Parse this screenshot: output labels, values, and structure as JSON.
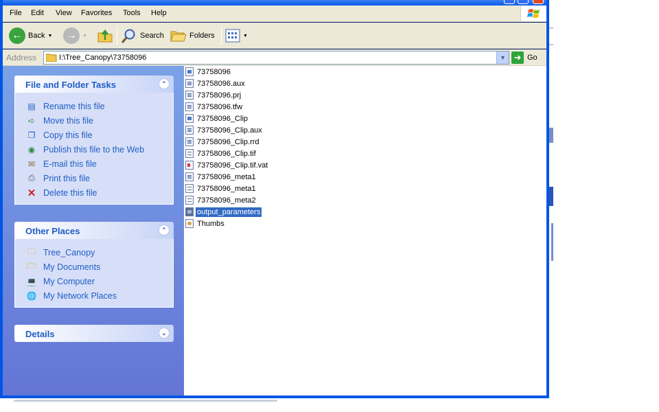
{
  "menu": {
    "items": [
      "File",
      "Edit",
      "View",
      "Favorites",
      "Tools",
      "Help"
    ]
  },
  "toolbar": {
    "back_label": "Back",
    "search_label": "Search",
    "folders_label": "Folders"
  },
  "address": {
    "label": "Address",
    "value": "I:\\Tree_Canopy\\73758096",
    "go_label": "Go"
  },
  "file_tasks": {
    "title": "File and Folder Tasks",
    "items": [
      {
        "label": "Rename this file",
        "icon": "rename-icon"
      },
      {
        "label": "Move this file",
        "icon": "move-icon"
      },
      {
        "label": "Copy this file",
        "icon": "copy-icon"
      },
      {
        "label": "Publish this file to the Web",
        "icon": "globe-icon"
      },
      {
        "label": "E-mail this file",
        "icon": "email-icon"
      },
      {
        "label": "Print this file",
        "icon": "printer-icon"
      },
      {
        "label": "Delete this file",
        "icon": "delete-icon"
      }
    ]
  },
  "other_places": {
    "title": "Other Places",
    "items": [
      {
        "label": "Tree_Canopy",
        "icon": "folder-icon"
      },
      {
        "label": "My Documents",
        "icon": "documents-icon"
      },
      {
        "label": "My Computer",
        "icon": "computer-icon"
      },
      {
        "label": "My Network Places",
        "icon": "network-icon"
      }
    ]
  },
  "details": {
    "title": "Details"
  },
  "files": [
    {
      "name": "73758096",
      "icon": "image-file-icon"
    },
    {
      "name": "73758096.aux",
      "icon": "grid-file-icon"
    },
    {
      "name": "73758096.prj",
      "icon": "grid-file-icon"
    },
    {
      "name": "73758096.tfw",
      "icon": "grid-file-icon"
    },
    {
      "name": "73758096_Clip",
      "icon": "image-file-icon"
    },
    {
      "name": "73758096_Clip.aux",
      "icon": "grid-file-icon"
    },
    {
      "name": "73758096_Clip.rrd",
      "icon": "grid-file-icon"
    },
    {
      "name": "73758096_Clip.tif",
      "icon": "text-file-icon"
    },
    {
      "name": "73758096_Clip.tif.vat",
      "icon": "pdf-file-icon"
    },
    {
      "name": "73758096_meta1",
      "icon": "grid-file-icon"
    },
    {
      "name": "73758096_meta1",
      "icon": "text-file-icon"
    },
    {
      "name": "73758096_meta2",
      "icon": "text-file-icon"
    },
    {
      "name": "output_parameters",
      "icon": "data-file-icon",
      "selected": true
    },
    {
      "name": "Thumbs",
      "icon": "thumbs-file-icon"
    }
  ],
  "colors": {
    "taskpane_link": "#215dc6",
    "selection": "#316ac5",
    "frame": "#0055e5"
  }
}
